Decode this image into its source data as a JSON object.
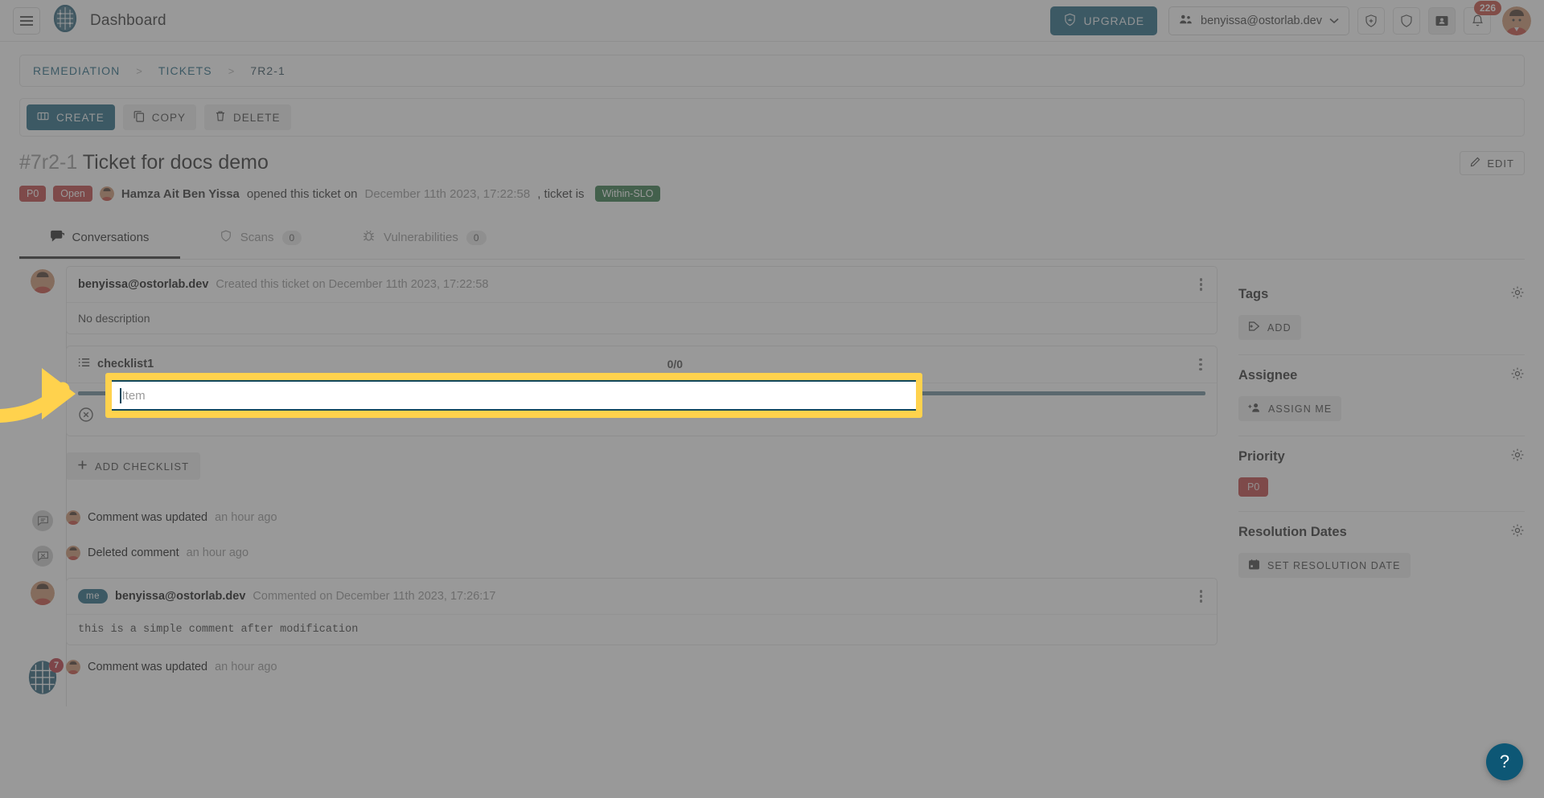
{
  "header": {
    "menu_icon": "hamburger-icon",
    "logo_icon": "ostorlab-logo-icon",
    "title": "Dashboard",
    "upgrade_label": "UPGRADE",
    "upgrade_icon": "crown-shield-icon",
    "user_email": "benyissa@ostorlab.dev",
    "user_icon": "group-icon",
    "chevron": "⌄",
    "icons": [
      {
        "name": "shield-plus-icon"
      },
      {
        "name": "shield-icon"
      },
      {
        "name": "id-card-icon"
      },
      {
        "name": "bell-icon",
        "badge": "226"
      }
    ],
    "avatar": "user-avatar"
  },
  "breadcrumb": {
    "items": [
      "REMEDIATION",
      "TICKETS",
      "7R2-1"
    ],
    "separator": ">"
  },
  "toolbar": {
    "create_label": "CREATE",
    "create_icon": "ticket-icon",
    "copy_label": "COPY",
    "copy_icon": "copy-icon",
    "delete_label": "DELETE",
    "delete_icon": "trash-icon"
  },
  "ticket": {
    "id": "#7r2-1",
    "title": "Ticket for docs demo",
    "edit_label": "EDIT",
    "edit_icon": "pencil-icon",
    "priority_badge": "P0",
    "status_badge": "Open",
    "author": "Hamza Ait Ben Yissa",
    "opened_text": "opened this ticket on",
    "opened_date": "December 11th 2023, 17:22:58",
    "ticket_is_text": ", ticket is",
    "slo_badge": "Within-SLO"
  },
  "tabs": [
    {
      "label": "Conversations",
      "icon": "conversation-icon",
      "count": null,
      "active": true
    },
    {
      "label": "Scans",
      "icon": "shield-icon",
      "count": "0",
      "active": false
    },
    {
      "label": "Vulnerabilities",
      "icon": "bug-icon",
      "count": "0",
      "active": false
    }
  ],
  "feed": {
    "created_card": {
      "author": "benyissa@ostorlab.dev",
      "action": "Created this ticket on December 11th 2023, 17:22:58",
      "body": "No description",
      "kebab_icon": "more-vertical-icon"
    },
    "checklist": {
      "icon": "list-icon",
      "name": "checklist1",
      "count": "0/0",
      "kebab_icon": "more-vertical-icon",
      "item_remove_icon": "remove-circle-icon",
      "item_placeholder": "Item",
      "item_value": ""
    },
    "add_checklist_label": "ADD CHECKLIST",
    "add_checklist_icon": "plus-icon",
    "activities": [
      {
        "icon": "comment-edit-icon",
        "avatar": "user-avatar",
        "text": "Comment was updated",
        "time": "an hour ago"
      },
      {
        "icon": "comment-delete-icon",
        "avatar": "user-avatar",
        "text": "Deleted comment",
        "time": "an hour ago"
      }
    ],
    "comment_card": {
      "me_tag": "me",
      "author": "benyissa@ostorlab.dev",
      "action": "Commented on December 11th 2023, 17:26:17",
      "body": "this is a simple comment after modification",
      "kebab_icon": "more-vertical-icon"
    },
    "logo_badge": "7",
    "last_activity": {
      "icon": "comment-edit-icon",
      "avatar": "user-avatar",
      "text": "Comment was updated",
      "time": "an hour ago"
    }
  },
  "sidebar": {
    "sections": [
      {
        "title": "Tags",
        "gear_icon": "gear-icon",
        "button_label": "ADD",
        "button_icon": "tag-plus-icon"
      },
      {
        "title": "Assignee",
        "gear_icon": "gear-icon",
        "button_label": "ASSIGN ME",
        "button_icon": "user-plus-icon"
      },
      {
        "title": "Priority",
        "gear_icon": "gear-icon",
        "pill": "P0"
      },
      {
        "title": "Resolution Dates",
        "gear_icon": "gear-icon",
        "button_label": "SET RESOLUTION DATE",
        "button_icon": "calendar-icon"
      }
    ]
  },
  "overlay": {
    "arrow_icon": "curved-arrow-right-icon",
    "highlight_color": "#ffd24d"
  },
  "help": {
    "label": "?",
    "icon": "help-icon"
  },
  "colors": {
    "accent": "#0d5775",
    "danger": "#b93030",
    "success": "#1e6a35",
    "highlight": "#ffd24d"
  }
}
